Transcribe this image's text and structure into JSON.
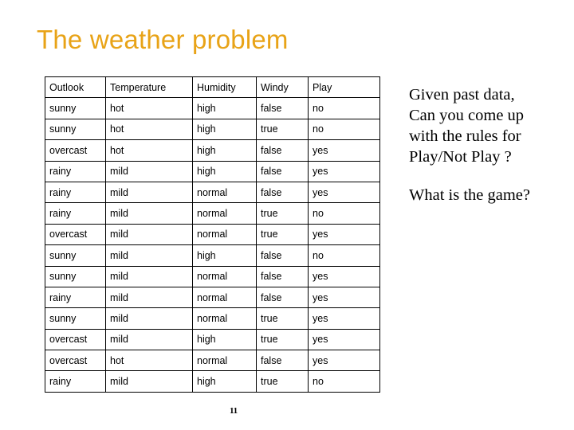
{
  "slide": {
    "title": "The weather problem",
    "title_color": "#E8A317",
    "page_number": "11"
  },
  "table": {
    "columns": [
      "Outlook",
      "Temperature",
      "Humidity",
      "Windy",
      "Play"
    ],
    "rows": [
      [
        "sunny",
        "hot",
        "high",
        "false",
        "no"
      ],
      [
        "sunny",
        "hot",
        "high",
        "true",
        "no"
      ],
      [
        "overcast",
        "hot",
        "high",
        "false",
        "yes"
      ],
      [
        "rainy",
        "mild",
        "high",
        "false",
        "yes"
      ],
      [
        "rainy",
        "mild",
        "normal",
        "false",
        "yes"
      ],
      [
        "rainy",
        "mild",
        "normal",
        "true",
        "no"
      ],
      [
        "overcast",
        "mild",
        "normal",
        "true",
        "yes"
      ],
      [
        "sunny",
        "mild",
        "high",
        "false",
        "no"
      ],
      [
        "sunny",
        "mild",
        "normal",
        "false",
        "yes"
      ],
      [
        "rainy",
        "mild",
        "normal",
        "false",
        "yes"
      ],
      [
        "sunny",
        "mild",
        "normal",
        "true",
        "yes"
      ],
      [
        "overcast",
        "mild",
        "high",
        "true",
        "yes"
      ],
      [
        "overcast",
        "hot",
        "normal",
        "false",
        "yes"
      ],
      [
        "rainy",
        "mild",
        "high",
        "true",
        "no"
      ]
    ]
  },
  "prompt": {
    "lines": [
      "Given past data,",
      "Can you come up",
      "with the rules for",
      "Play/Not Play ?"
    ],
    "question": "What is the game?"
  }
}
